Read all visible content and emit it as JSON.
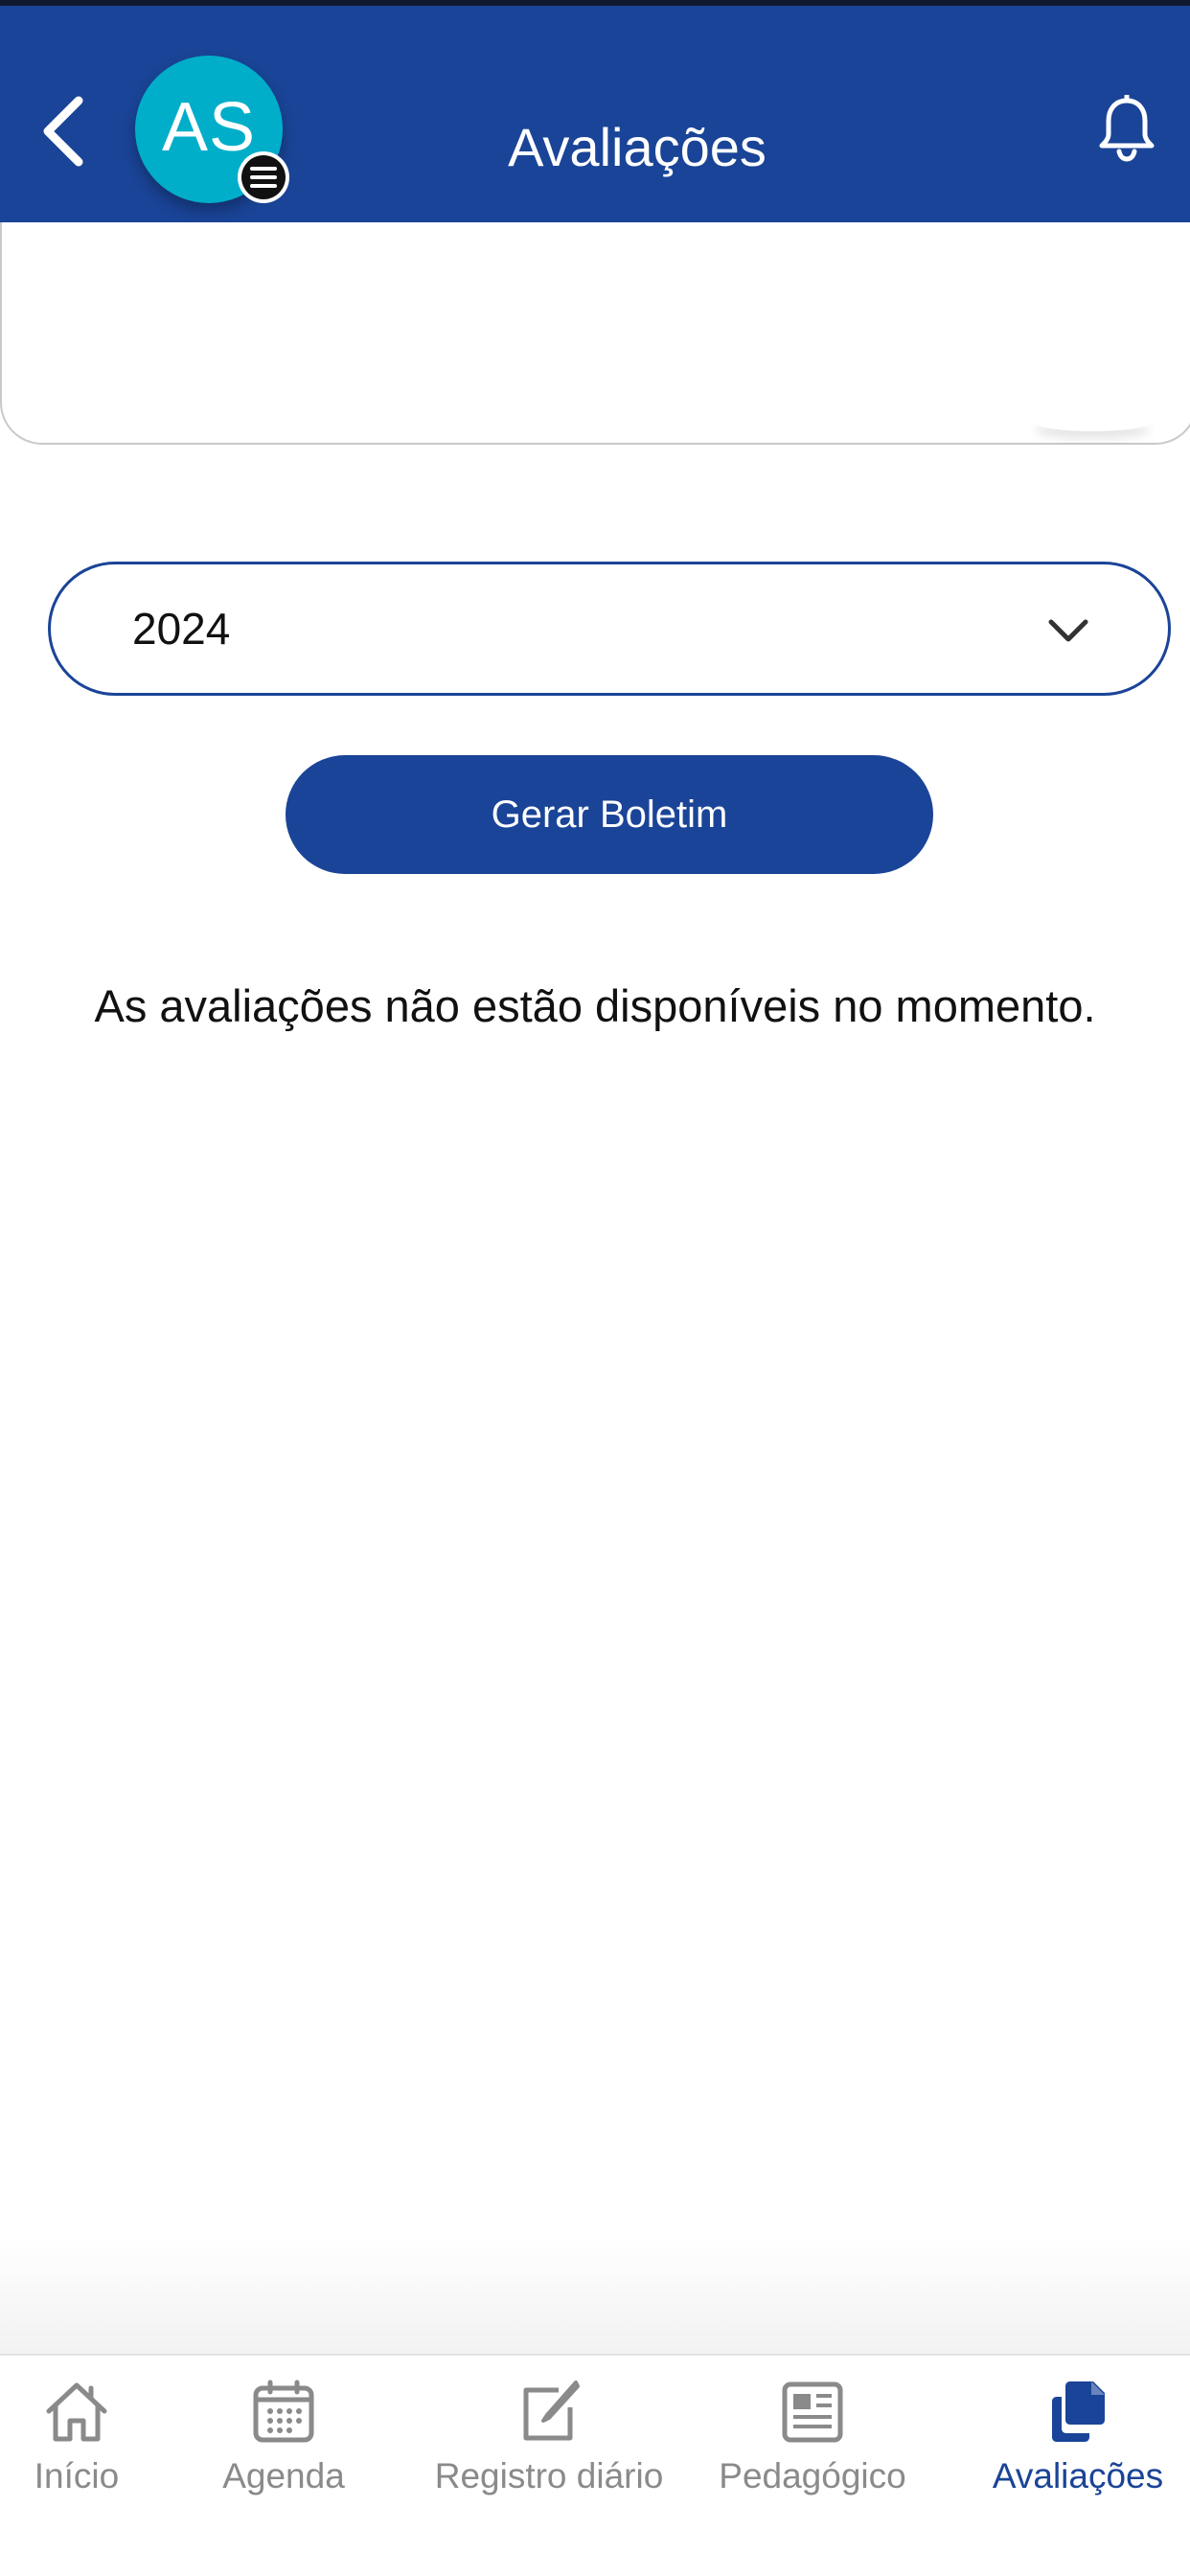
{
  "header": {
    "title": "Avaliações",
    "avatar_initials": "AS",
    "back_icon": "chevron-left-icon",
    "bell_icon": "bell-icon",
    "avatar_color": "#00aec9",
    "bar_color": "#1a4497"
  },
  "filters": {
    "year_selected": "2024",
    "select_icon": "chevron-down-icon"
  },
  "actions": {
    "generate_report_label": "Gerar Boletim"
  },
  "content": {
    "empty_message": "As avaliações não estão disponíveis no momento."
  },
  "bottom_nav": {
    "active_color": "#1a4497",
    "inactive_color": "#8a8a8a",
    "items": [
      {
        "label": "Início",
        "icon": "home-icon",
        "active": false
      },
      {
        "label": "Agenda",
        "icon": "calendar-icon",
        "active": false
      },
      {
        "label": "Registro diário",
        "icon": "edit-icon",
        "active": false
      },
      {
        "label": "Pedagógico",
        "icon": "newspaper-icon",
        "active": false
      },
      {
        "label": "Avaliações",
        "icon": "documents-icon",
        "active": true
      }
    ]
  }
}
